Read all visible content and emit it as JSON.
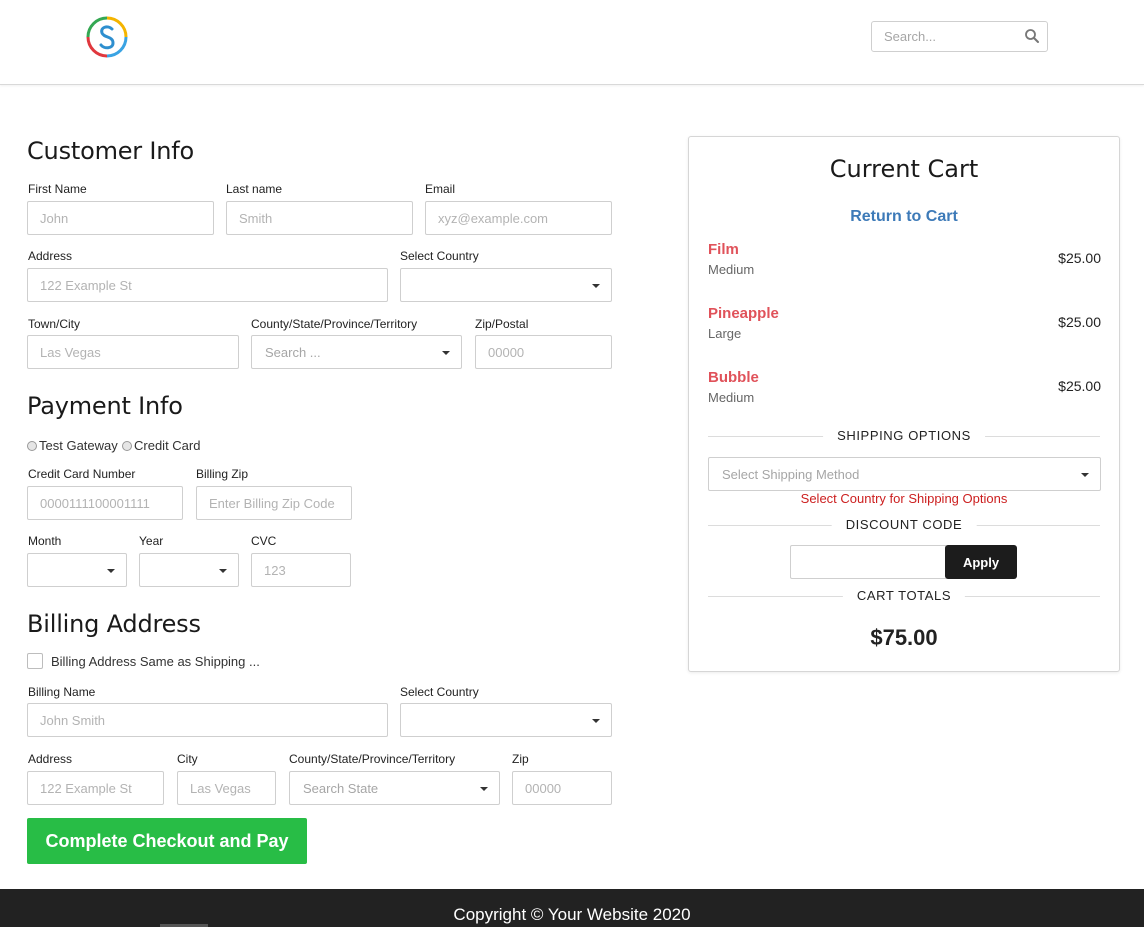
{
  "header": {
    "search_placeholder": "Search..."
  },
  "customer_info": {
    "heading": "Customer Info",
    "first_name": {
      "label": "First Name",
      "placeholder": "John"
    },
    "last_name": {
      "label": "Last name",
      "placeholder": "Smith"
    },
    "email": {
      "label": "Email",
      "placeholder": "xyz@example.com"
    },
    "address": {
      "label": "Address",
      "placeholder": "122 Example St"
    },
    "country": {
      "label": "Select Country",
      "value": ""
    },
    "city": {
      "label": "Town/City",
      "placeholder": "Las Vegas"
    },
    "state": {
      "label": "County/State/Province/Territory",
      "placeholder": "Search ..."
    },
    "zip": {
      "label": "Zip/Postal",
      "placeholder": "00000"
    }
  },
  "payment_info": {
    "heading": "Payment Info",
    "gateways": [
      {
        "label": "Test Gateway",
        "selected": false
      },
      {
        "label": "Credit Card",
        "selected": false
      }
    ],
    "card_number": {
      "label": "Credit Card Number",
      "placeholder": "0000111100001111"
    },
    "billing_zip": {
      "label": "Billing Zip",
      "placeholder": "Enter Billing Zip Code"
    },
    "month": {
      "label": "Month",
      "value": ""
    },
    "year": {
      "label": "Year",
      "value": ""
    },
    "cvc": {
      "label": "CVC",
      "placeholder": "123"
    }
  },
  "billing_address": {
    "heading": "Billing Address",
    "same_as_shipping": {
      "label": "Billing Address Same as Shipping ...",
      "checked": false
    },
    "name": {
      "label": "Billing Name",
      "placeholder": "John Smith"
    },
    "country": {
      "label": "Select Country",
      "value": ""
    },
    "address": {
      "label": "Address",
      "placeholder": "122 Example St"
    },
    "city": {
      "label": "City",
      "placeholder": "Las Vegas"
    },
    "state": {
      "label": "County/State/Province/Territory",
      "placeholder": "Search State"
    },
    "zip": {
      "label": "Zip",
      "placeholder": "00000"
    }
  },
  "submit_label": "Complete Checkout and Pay",
  "cart": {
    "title": "Current Cart",
    "return_link": "Return to Cart",
    "items": [
      {
        "name": "Film",
        "variant": "Medium",
        "price": "$25.00"
      },
      {
        "name": "Pineapple",
        "variant": "Large",
        "price": "$25.00"
      },
      {
        "name": "Bubble",
        "variant": "Medium",
        "price": "$25.00"
      }
    ],
    "shipping_heading": "SHIPPING OPTIONS",
    "shipping_placeholder": "Select Shipping Method",
    "shipping_warning": "Select Country for Shipping Options",
    "discount_heading": "DISCOUNT CODE",
    "discount_value": "",
    "apply_label": "Apply",
    "totals_heading": "CART TOTALS",
    "total": "$75.00"
  },
  "footer": {
    "copyright": "Copyright © Your Website 2020"
  },
  "colors": {
    "accent_green": "#28bd46",
    "item_name": "#e0525a",
    "link_blue": "#3d7ab8",
    "warning_red": "#cc1f1f",
    "footer_bg": "#222222"
  }
}
